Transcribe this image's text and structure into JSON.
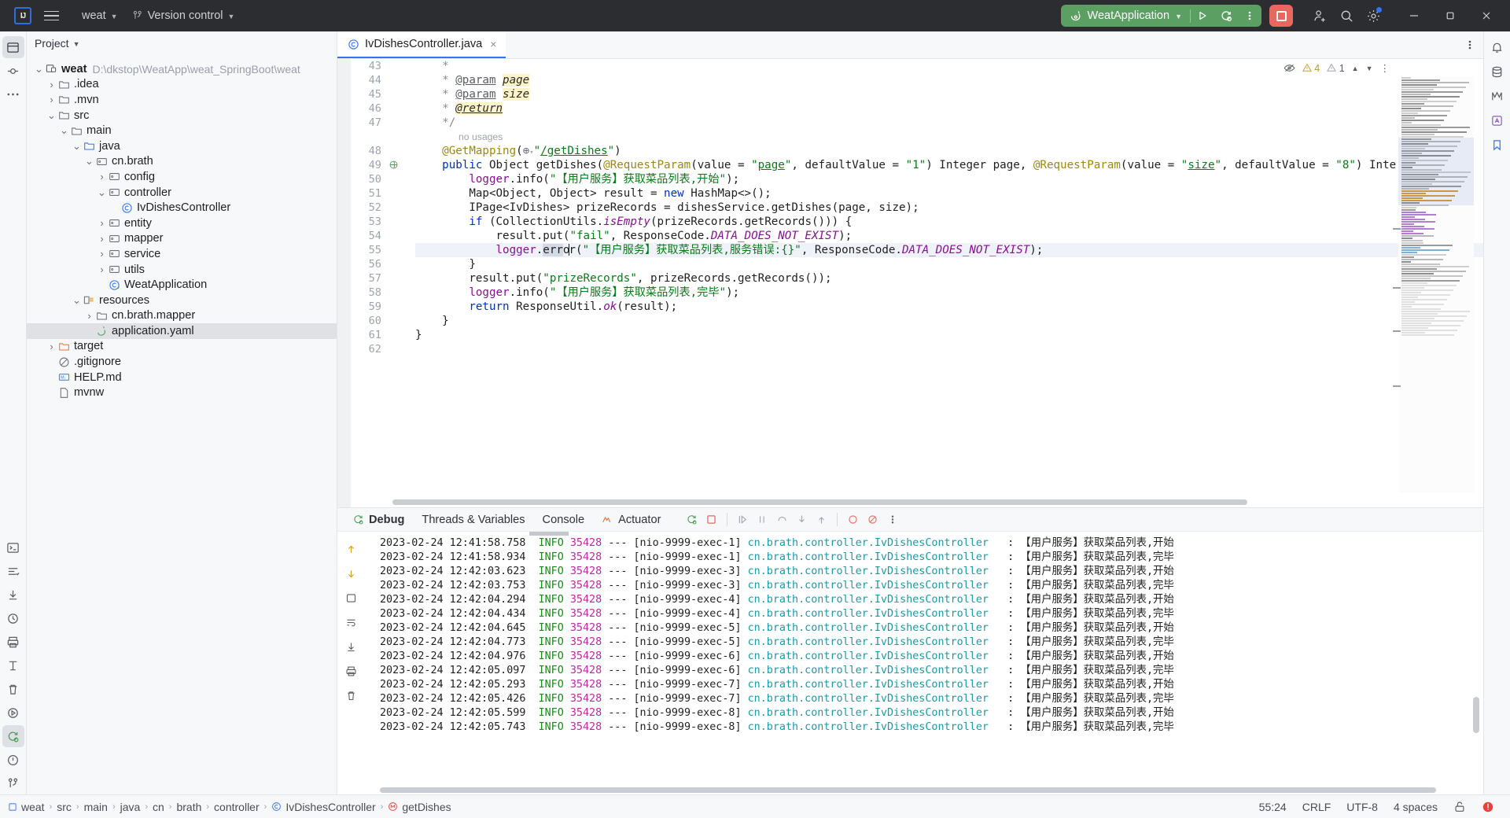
{
  "topbar": {
    "logo_text": "IJ",
    "project_name": "weat",
    "version_control": "Version control",
    "run_config": "WeatApplication",
    "icons": {
      "menu": "hamburger-menu-icon",
      "vcs": "branch-icon",
      "run": "run-icon",
      "debug": "debug-icon",
      "more": "more-vertical-icon",
      "stop": "stop-icon",
      "share": "add-user-icon",
      "search": "search-icon",
      "settings": "gear-icon",
      "minimize": "minimize-icon",
      "maximize": "maximize-icon",
      "close": "close-icon"
    }
  },
  "project": {
    "title": "Project",
    "root": {
      "label": "weat",
      "path": "D:\\dkstop\\WeatApp\\weat_SpringBoot\\weat"
    },
    "items": [
      {
        "label": "weat",
        "path": "D:\\dkstop\\WeatApp\\weat_SpringBoot\\weat",
        "indent": 0,
        "twisty": "v",
        "icon": "module-icon",
        "bold": true
      },
      {
        "label": ".idea",
        "path": "",
        "indent": 1,
        "twisty": ">",
        "icon": "folder-icon"
      },
      {
        "label": ".mvn",
        "path": "",
        "indent": 1,
        "twisty": ">",
        "icon": "folder-icon"
      },
      {
        "label": "src",
        "path": "",
        "indent": 1,
        "twisty": "v",
        "icon": "folder-icon"
      },
      {
        "label": "main",
        "path": "",
        "indent": 2,
        "twisty": "v",
        "icon": "folder-icon"
      },
      {
        "label": "java",
        "path": "",
        "indent": 3,
        "twisty": "v",
        "icon": "source-root-icon"
      },
      {
        "label": "cn.brath",
        "path": "",
        "indent": 4,
        "twisty": "v",
        "icon": "package-icon"
      },
      {
        "label": "config",
        "path": "",
        "indent": 5,
        "twisty": ">",
        "icon": "package-icon"
      },
      {
        "label": "controller",
        "path": "",
        "indent": 5,
        "twisty": "v",
        "icon": "package-icon"
      },
      {
        "label": "IvDishesController",
        "path": "",
        "indent": 6,
        "twisty": "",
        "icon": "java-class-icon"
      },
      {
        "label": "entity",
        "path": "",
        "indent": 5,
        "twisty": ">",
        "icon": "package-icon"
      },
      {
        "label": "mapper",
        "path": "",
        "indent": 5,
        "twisty": ">",
        "icon": "package-icon"
      },
      {
        "label": "service",
        "path": "",
        "indent": 5,
        "twisty": ">",
        "icon": "package-icon"
      },
      {
        "label": "utils",
        "path": "",
        "indent": 5,
        "twisty": ">",
        "icon": "package-icon"
      },
      {
        "label": "WeatApplication",
        "path": "",
        "indent": 5,
        "twisty": "",
        "icon": "spring-class-icon"
      },
      {
        "label": "resources",
        "path": "",
        "indent": 3,
        "twisty": "v",
        "icon": "resource-root-icon"
      },
      {
        "label": "cn.brath.mapper",
        "path": "",
        "indent": 4,
        "twisty": ">",
        "icon": "folder-icon"
      },
      {
        "label": "application.yaml",
        "path": "",
        "indent": 4,
        "twisty": "",
        "icon": "yaml-icon",
        "selected": true
      },
      {
        "label": "target",
        "path": "",
        "indent": 1,
        "twisty": ">",
        "icon": "target-folder-icon"
      },
      {
        "label": ".gitignore",
        "path": "",
        "indent": 1,
        "twisty": "",
        "icon": "gitignore-icon"
      },
      {
        "label": "HELP.md",
        "path": "",
        "indent": 1,
        "twisty": "",
        "icon": "markdown-icon"
      },
      {
        "label": "mvnw",
        "path": "",
        "indent": 1,
        "twisty": "",
        "icon": "file-icon"
      }
    ]
  },
  "editor": {
    "tab": {
      "label": "IvDishesController.java",
      "icon": "java-class-icon",
      "close": "×"
    },
    "inspection": {
      "warnings": "4",
      "weak_warnings": "1",
      "eye": "inspection-eye-icon"
    },
    "no_usages_label": "no usages",
    "first_line_number": 43,
    "lines": [
      {
        "n": 43,
        "indent": 4,
        "kind": "doc",
        "text": "*"
      },
      {
        "n": 44,
        "indent": 4,
        "kind": "docparam",
        "text": "* @param page",
        "tag": "@param",
        "param": "page"
      },
      {
        "n": 45,
        "indent": 4,
        "kind": "docparam",
        "text": "* @param size",
        "tag": "@param",
        "param": "size"
      },
      {
        "n": 46,
        "indent": 4,
        "kind": "docreturn",
        "text": "* @return",
        "tag": "@return"
      },
      {
        "n": 47,
        "indent": 4,
        "kind": "doc",
        "text": "*/"
      },
      {
        "n": 48,
        "indent": 4,
        "kind": "mapping",
        "text": "@GetMapping(\"/getDishes\")"
      },
      {
        "n": 49,
        "indent": 4,
        "kind": "signature",
        "text": "public Object getDishes(@RequestParam(value = \"page\", defaultValue = \"1\") Integer page, @RequestParam(value = \"size\", defaultValue = \"8\") Inte"
      },
      {
        "n": 50,
        "indent": 8,
        "kind": "code",
        "text": "logger.info(\"【用户服务】获取菜品列表,开始\");"
      },
      {
        "n": 51,
        "indent": 8,
        "kind": "code",
        "text": "Map<Object, Object> result = new HashMap<>();"
      },
      {
        "n": 52,
        "indent": 8,
        "kind": "code",
        "text": "IPage<IvDishes> prizeRecords = dishesService.getDishes(page, size);"
      },
      {
        "n": 53,
        "indent": 8,
        "kind": "code",
        "text": "if (CollectionUtils.isEmpty(prizeRecords.getRecords())) {"
      },
      {
        "n": 54,
        "indent": 12,
        "kind": "code",
        "text": "result.put(\"fail\", ResponseCode.DATA_DOES_NOT_EXIST);"
      },
      {
        "n": 55,
        "indent": 12,
        "kind": "code",
        "text": "logger.error(\"【用户服务】获取菜品列表,服务错误:{}\", ResponseCode.DATA_DOES_NOT_EXIST);",
        "highlighted": true
      },
      {
        "n": 56,
        "indent": 8,
        "kind": "code",
        "text": "}"
      },
      {
        "n": 57,
        "indent": 8,
        "kind": "code",
        "text": "result.put(\"prizeRecords\", prizeRecords.getRecords());"
      },
      {
        "n": 58,
        "indent": 8,
        "kind": "code",
        "text": "logger.info(\"【用户服务】获取菜品列表,完毕\");"
      },
      {
        "n": 59,
        "indent": 8,
        "kind": "code",
        "text": "return ResponseUtil.ok(result);"
      },
      {
        "n": 60,
        "indent": 4,
        "kind": "code",
        "text": "}"
      },
      {
        "n": 61,
        "indent": 0,
        "kind": "code",
        "text": "}"
      },
      {
        "n": 62,
        "indent": 0,
        "kind": "code",
        "text": ""
      }
    ]
  },
  "debug": {
    "tabs": [
      {
        "label": "Debug",
        "icon": "debug-icon",
        "active": true
      },
      {
        "label": "Threads & Variables",
        "icon": "",
        "active": false
      },
      {
        "label": "Console",
        "icon": "",
        "active": false
      },
      {
        "label": "Actuator",
        "icon": "actuator-icon",
        "active": false
      }
    ],
    "toolbar_icons": [
      "rerun-icon",
      "stop-icon",
      "resume-icon",
      "pause-icon",
      "step-over-icon",
      "step-into-icon",
      "step-out-icon",
      "mute-breakpoints-icon",
      "view-breakpoints-icon",
      "more-vertical-icon"
    ],
    "side_icons": [
      "up-icon",
      "down-icon",
      "soft-wrap-icon",
      "scroll-end-icon",
      "print-icon",
      "clear-icon",
      "settings-icon"
    ],
    "logs": [
      {
        "ts": "2023-02-24 12:41:58.758",
        "level": "INFO",
        "pid": "35428",
        "thread": "[nio-9999-exec-1]",
        "cls": "cn.brath.controller.IvDishesController",
        "msg": "【用户服务】获取菜品列表,开始"
      },
      {
        "ts": "2023-02-24 12:41:58.934",
        "level": "INFO",
        "pid": "35428",
        "thread": "[nio-9999-exec-1]",
        "cls": "cn.brath.controller.IvDishesController",
        "msg": "【用户服务】获取菜品列表,完毕"
      },
      {
        "ts": "2023-02-24 12:42:03.623",
        "level": "INFO",
        "pid": "35428",
        "thread": "[nio-9999-exec-3]",
        "cls": "cn.brath.controller.IvDishesController",
        "msg": "【用户服务】获取菜品列表,开始"
      },
      {
        "ts": "2023-02-24 12:42:03.753",
        "level": "INFO",
        "pid": "35428",
        "thread": "[nio-9999-exec-3]",
        "cls": "cn.brath.controller.IvDishesController",
        "msg": "【用户服务】获取菜品列表,完毕"
      },
      {
        "ts": "2023-02-24 12:42:04.294",
        "level": "INFO",
        "pid": "35428",
        "thread": "[nio-9999-exec-4]",
        "cls": "cn.brath.controller.IvDishesController",
        "msg": "【用户服务】获取菜品列表,开始"
      },
      {
        "ts": "2023-02-24 12:42:04.434",
        "level": "INFO",
        "pid": "35428",
        "thread": "[nio-9999-exec-4]",
        "cls": "cn.brath.controller.IvDishesController",
        "msg": "【用户服务】获取菜品列表,完毕"
      },
      {
        "ts": "2023-02-24 12:42:04.645",
        "level": "INFO",
        "pid": "35428",
        "thread": "[nio-9999-exec-5]",
        "cls": "cn.brath.controller.IvDishesController",
        "msg": "【用户服务】获取菜品列表,开始"
      },
      {
        "ts": "2023-02-24 12:42:04.773",
        "level": "INFO",
        "pid": "35428",
        "thread": "[nio-9999-exec-5]",
        "cls": "cn.brath.controller.IvDishesController",
        "msg": "【用户服务】获取菜品列表,完毕"
      },
      {
        "ts": "2023-02-24 12:42:04.976",
        "level": "INFO",
        "pid": "35428",
        "thread": "[nio-9999-exec-6]",
        "cls": "cn.brath.controller.IvDishesController",
        "msg": "【用户服务】获取菜品列表,开始"
      },
      {
        "ts": "2023-02-24 12:42:05.097",
        "level": "INFO",
        "pid": "35428",
        "thread": "[nio-9999-exec-6]",
        "cls": "cn.brath.controller.IvDishesController",
        "msg": "【用户服务】获取菜品列表,完毕"
      },
      {
        "ts": "2023-02-24 12:42:05.293",
        "level": "INFO",
        "pid": "35428",
        "thread": "[nio-9999-exec-7]",
        "cls": "cn.brath.controller.IvDishesController",
        "msg": "【用户服务】获取菜品列表,开始"
      },
      {
        "ts": "2023-02-24 12:42:05.426",
        "level": "INFO",
        "pid": "35428",
        "thread": "[nio-9999-exec-7]",
        "cls": "cn.brath.controller.IvDishesController",
        "msg": "【用户服务】获取菜品列表,完毕"
      },
      {
        "ts": "2023-02-24 12:42:05.599",
        "level": "INFO",
        "pid": "35428",
        "thread": "[nio-9999-exec-8]",
        "cls": "cn.brath.controller.IvDishesController",
        "msg": "【用户服务】获取菜品列表,开始"
      },
      {
        "ts": "2023-02-24 12:42:05.743",
        "level": "INFO",
        "pid": "35428",
        "thread": "[nio-9999-exec-8]",
        "cls": "cn.brath.controller.IvDishesController",
        "msg": "【用户服务】获取菜品列表,完毕"
      }
    ]
  },
  "statusbar": {
    "breadcrumbs": [
      {
        "label": "weat",
        "icon": "module-icon"
      },
      {
        "label": "src",
        "icon": ""
      },
      {
        "label": "main",
        "icon": ""
      },
      {
        "label": "java",
        "icon": ""
      },
      {
        "label": "cn",
        "icon": ""
      },
      {
        "label": "brath",
        "icon": ""
      },
      {
        "label": "controller",
        "icon": ""
      },
      {
        "label": "IvDishesController",
        "icon": "java-class-icon"
      },
      {
        "label": "getDishes",
        "icon": "method-icon"
      }
    ],
    "caret": "55:24",
    "line_sep": "CRLF",
    "encoding": "UTF-8",
    "indent": "4 spaces",
    "lock": "unlock-icon",
    "error_badge": "error-icon"
  },
  "colors": {
    "accent_blue": "#3574f0",
    "run_green": "#5c9f62",
    "stop_red": "#e8685f",
    "topbar_bg": "#2b2d30",
    "panel_bg": "#f7f8fa",
    "editor_bg": "#ffffff",
    "warning": "#b89b2e"
  }
}
